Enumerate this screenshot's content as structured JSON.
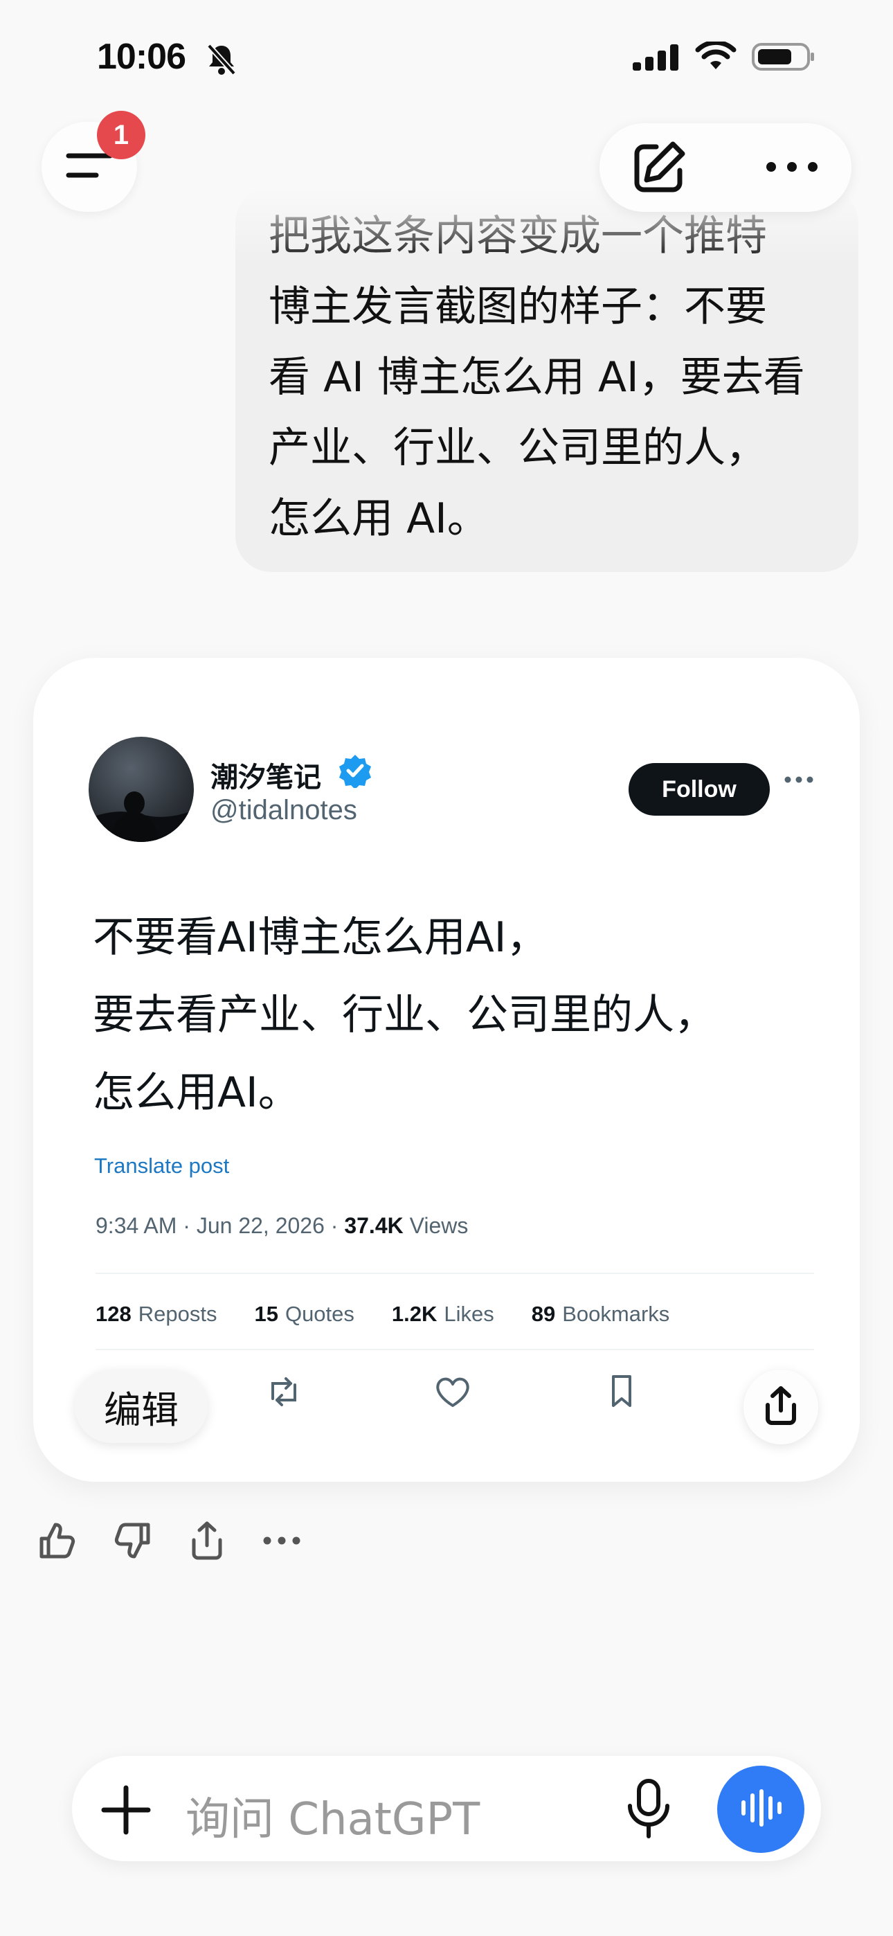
{
  "status_bar": {
    "time": "10:06"
  },
  "header": {
    "notification_count": "1"
  },
  "user_message": {
    "lines": [
      "把我这条内容变成一个推特",
      "博主发言截图的样子：不要",
      "看 AI 博主怎么用 AI，要去看",
      "产业、行业、公司里的人，",
      "怎么用 AI。"
    ]
  },
  "tweet": {
    "display_name": "潮汐笔记",
    "handle": "@tidalnotes",
    "follow_label": "Follow",
    "body_lines": [
      "不要看AI博主怎么用AI，",
      "要去看产业、行业、公司里的人，",
      "怎么用AI。"
    ],
    "translate_label": "Translate post",
    "timestamp": "9:34 AM · Jun 22, 2026 · ",
    "views_count": "37.4K",
    "views_label": " Views",
    "stats": [
      {
        "count": "128",
        "label": "Reposts"
      },
      {
        "count": "15",
        "label": "Quotes"
      },
      {
        "count": "1.2K",
        "label": "Likes"
      },
      {
        "count": "89",
        "label": "Bookmarks"
      }
    ],
    "actions": [
      "reply-icon",
      "repost-icon",
      "heart-icon",
      "bookmark-icon"
    ]
  },
  "overlay": {
    "edit_label": "编辑"
  },
  "composer": {
    "placeholder": "询问 ChatGPT"
  },
  "colors": {
    "accent_blue": "#2f7cf6",
    "badge_red": "#e5484d",
    "verified_blue": "#1d9bf0",
    "link_blue": "#1d78c4"
  }
}
